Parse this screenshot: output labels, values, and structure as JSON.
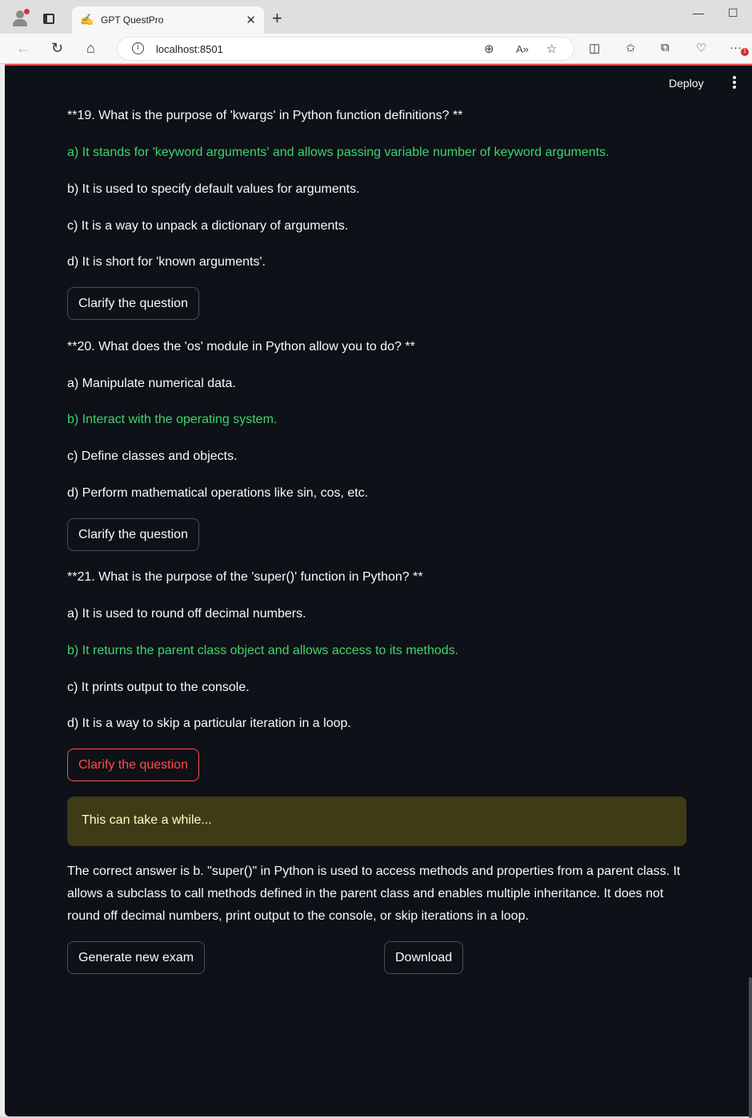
{
  "browser": {
    "tab_title": "GPT QuestPro",
    "url": "localhost:8501",
    "notification_count": "1"
  },
  "header": {
    "deploy_label": "Deploy"
  },
  "questions": [
    {
      "question": "**19. What is the purpose of 'kwargs' in Python function definitions? **",
      "options": [
        "a) It stands for 'keyword arguments' and allows passing variable number of keyword arguments.",
        "b) It is used to specify default values for arguments.",
        "c) It is a way to unpack a dictionary of arguments.",
        "d) It is short for 'known arguments'."
      ],
      "correct_index": 0,
      "clarify_label": "Clarify the question"
    },
    {
      "question": "**20. What does the 'os' module in Python allow you to do? **",
      "options": [
        "a) Manipulate numerical data.",
        "b) Interact with the operating system.",
        "c) Define classes and objects.",
        "d) Perform mathematical operations like sin, cos, etc."
      ],
      "correct_index": 1,
      "clarify_label": "Clarify the question"
    },
    {
      "question": "**21. What is the purpose of the 'super()' function in Python? **",
      "options": [
        "a) It is used to round off decimal numbers.",
        "b) It returns the parent class object and allows access to its methods.",
        "c) It prints output to the console.",
        "d) It is a way to skip a particular iteration in a loop."
      ],
      "correct_index": 1,
      "clarify_label": "Clarify the question"
    }
  ],
  "status_message": "This can take a while...",
  "answer_text": "The correct answer is b. \"super()\" in Python is used to access methods and properties from a parent class. It allows a subclass to call methods defined in the parent class and enables multiple inheritance. It does not round off decimal numbers, print output to the console, or skip iterations in a loop.",
  "actions": {
    "generate_label": "Generate new exam",
    "download_label": "Download"
  },
  "colors": {
    "correct": "#3dd56d",
    "accent": "#ff4b4b",
    "background": "#0e1117",
    "warning_bg": "#3e3b16"
  }
}
